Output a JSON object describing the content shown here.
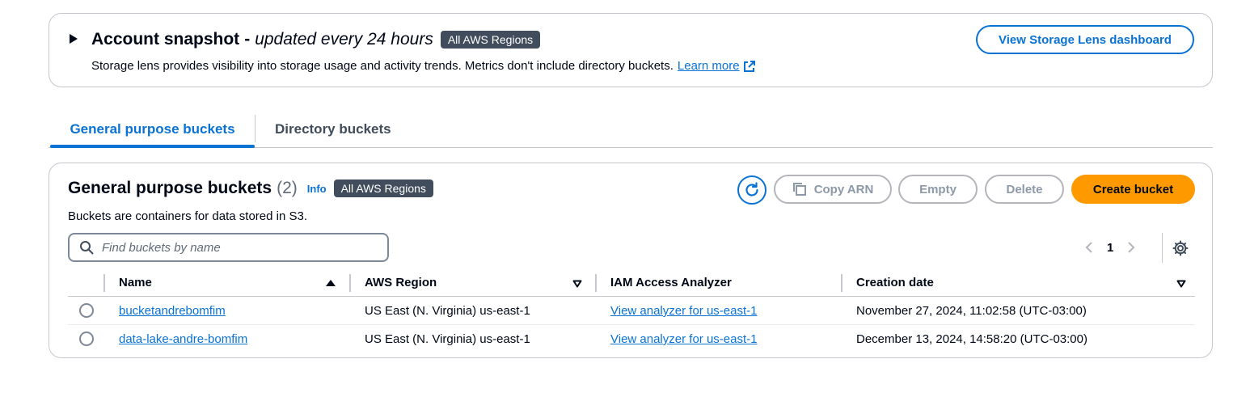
{
  "snapshot": {
    "title": "Account snapshot",
    "separator": "-",
    "subtitle": "updated every 24 hours",
    "badge": "All AWS Regions",
    "description": "Storage lens provides visibility into storage usage and activity trends. Metrics don't include directory buckets.",
    "learn_more": "Learn more",
    "lens_button": "View Storage Lens dashboard"
  },
  "tabs": [
    {
      "label": "General purpose buckets",
      "active": true
    },
    {
      "label": "Directory buckets",
      "active": false
    }
  ],
  "buckets_panel": {
    "title": "General purpose buckets",
    "count": "(2)",
    "info": "Info",
    "badge": "All AWS Regions",
    "subtitle": "Buckets are containers for data stored in S3.",
    "buttons": {
      "copy_arn": "Copy ARN",
      "empty": "Empty",
      "delete": "Delete",
      "create": "Create bucket"
    },
    "search_placeholder": "Find buckets by name",
    "page": "1",
    "columns": [
      "Name",
      "AWS Region",
      "IAM Access Analyzer",
      "Creation date"
    ],
    "rows": [
      {
        "name": "bucketandrebomfim",
        "region": "US East (N. Virginia) us-east-1",
        "analyzer": "View analyzer for us-east-1",
        "created": "November 27, 2024, 11:02:58 (UTC-03:00)"
      },
      {
        "name": "data-lake-andre-bomfim",
        "region": "US East (N. Virginia) us-east-1",
        "analyzer": "View analyzer for us-east-1",
        "created": "December 13, 2024, 14:58:20 (UTC-03:00)"
      }
    ]
  },
  "colors": {
    "accent": "#0972d3",
    "primary_button": "#ff9900",
    "badge_bg": "#414d5c",
    "text": "#000716"
  }
}
